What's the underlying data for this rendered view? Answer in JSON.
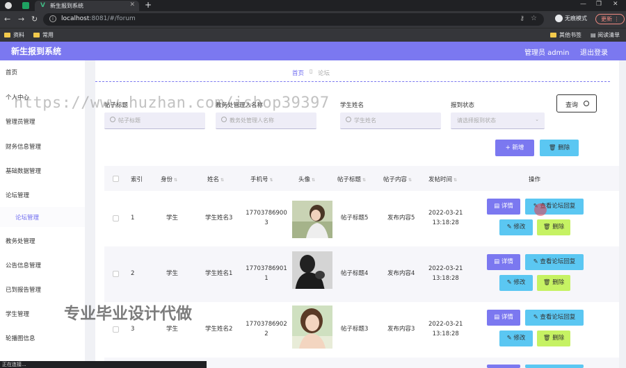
{
  "browser": {
    "tab_title": "新生报到系统",
    "tab_logo": "V",
    "url_host": "localhost",
    "url_rest": ":8081/#/forum",
    "incognito_label": "无痕模式",
    "update_label": "更新",
    "bookmarks": [
      "资料",
      "常用"
    ],
    "bookmarks_right": [
      "其他书签",
      "阅读清单"
    ]
  },
  "app": {
    "title": "新生报到系统",
    "user_label": "管理员 admin",
    "logout_label": "退出登录"
  },
  "sidebar": {
    "items": [
      "首页",
      "个人中心",
      "管理员管理",
      "财务信息管理",
      "基础数据管理",
      "论坛管理",
      "教务处管理",
      "公告信息管理",
      "已到报告管理",
      "学生管理",
      "轮播图信息"
    ],
    "sub_item": "论坛管理"
  },
  "breadcrumb": {
    "home": "首页",
    "current": "论坛"
  },
  "filters": {
    "post_title_label": "帖子标题",
    "post_title_placeholder": "帖子标题",
    "staff_name_label": "教务处管理人名称",
    "staff_name_placeholder": "教务处管理人名称",
    "student_name_label": "学生姓名",
    "student_name_placeholder": "学生姓名",
    "status_label": "报到状态",
    "status_placeholder": "请选择报到状态",
    "search_label": "查询"
  },
  "toolbar": {
    "add_label": "新增",
    "delete_label": "删除"
  },
  "table": {
    "headers": [
      "索引",
      "身份",
      "姓名",
      "手机号",
      "头像",
      "帖子标题",
      "帖子内容",
      "发帖时间",
      "操作"
    ],
    "rows": [
      {
        "index": "1",
        "identity": "学生",
        "name": "学生姓名3",
        "phone1": "17703786900",
        "phone2": "3",
        "title": "帖子标题5",
        "content": "发布内容5",
        "date": "2022-03-21",
        "time": "13:18:28"
      },
      {
        "index": "2",
        "identity": "学生",
        "name": "学生姓名1",
        "phone1": "17703786901",
        "phone2": "1",
        "title": "帖子标题4",
        "content": "发布内容4",
        "date": "2022-03-21",
        "time": "13:18:28"
      },
      {
        "index": "3",
        "identity": "学生",
        "name": "学生姓名2",
        "phone1": "17703786902",
        "phone2": "2",
        "title": "帖子标题3",
        "content": "发布内容3",
        "date": "2022-03-21",
        "time": "13:18:28"
      }
    ],
    "ops": {
      "detail": "详情",
      "reply": "查看论坛回复",
      "edit": "修改",
      "delete": "删除"
    }
  },
  "overlay": {
    "watermark": "https://www.huzhan.com/ishop39397",
    "promo": "专业毕业设计代做",
    "status": "正在连接..."
  },
  "colors": {
    "accent": "#7b78f0",
    "info": "#5bc7f2",
    "lime": "#c6f263"
  }
}
